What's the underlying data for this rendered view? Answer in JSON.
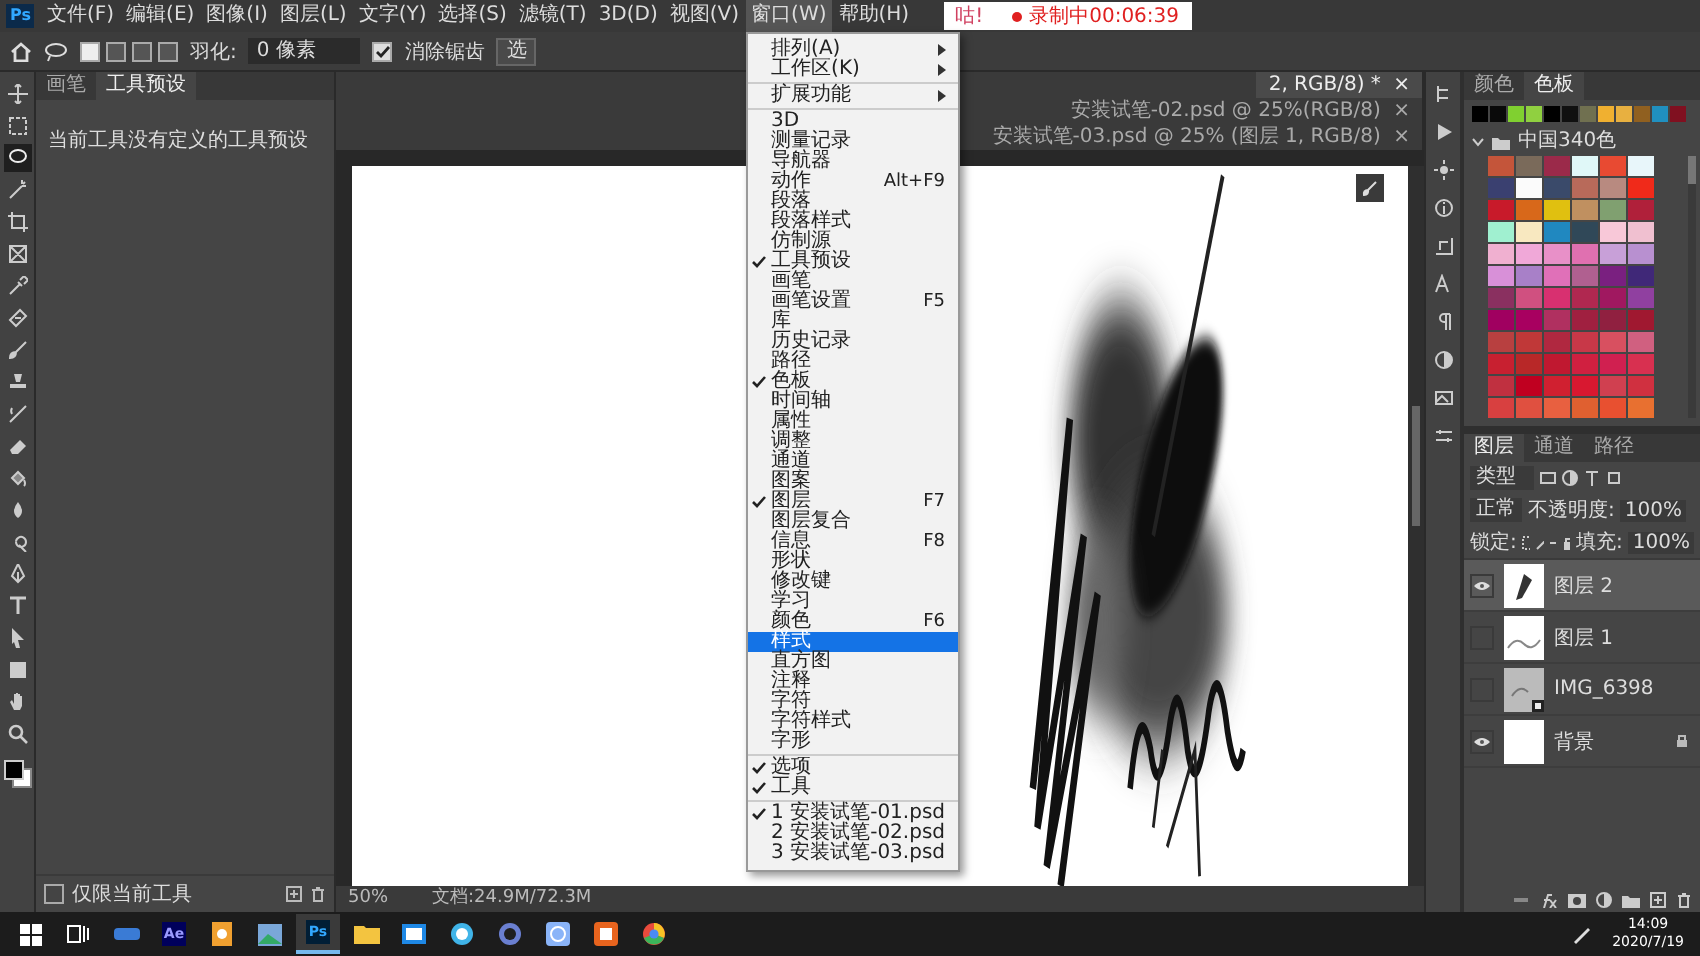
{
  "menu_bar": {
    "logo": "Ps",
    "items": [
      {
        "label": "文件(F)",
        "open": false
      },
      {
        "label": "编辑(E)",
        "open": false
      },
      {
        "label": "图像(I)",
        "open": false
      },
      {
        "label": "图层(L)",
        "open": false
      },
      {
        "label": "文字(Y)",
        "open": false
      },
      {
        "label": "选择(S)",
        "open": false
      },
      {
        "label": "滤镜(T)",
        "open": false
      },
      {
        "label": "3D(D)",
        "open": false
      },
      {
        "label": "视图(V)",
        "open": false
      },
      {
        "label": "窗口(W)",
        "open": true
      },
      {
        "label": "帮助(H)",
        "open": false
      }
    ]
  },
  "recording": {
    "app": "咕!",
    "status": "录制中00:06:39"
  },
  "window_menu": {
    "groups": [
      {
        "items": [
          {
            "label": "排列(A)",
            "kind": "submenu",
            "checked": false,
            "selected": false
          },
          {
            "label": "工作区(K)",
            "kind": "submenu",
            "checked": false,
            "selected": false
          }
        ]
      },
      {
        "items": [
          {
            "label": "扩展功能",
            "kind": "submenu",
            "checked": false,
            "selected": false
          }
        ]
      },
      {
        "items": [
          {
            "label": "3D",
            "kind": "command",
            "checked": false,
            "selected": false
          },
          {
            "label": "测量记录",
            "kind": "command",
            "checked": false,
            "selected": false
          },
          {
            "label": "导航器",
            "kind": "command",
            "checked": false,
            "selected": false
          },
          {
            "label": "动作",
            "shortcut": "Alt+F9",
            "kind": "command",
            "checked": false,
            "selected": false
          },
          {
            "label": "段落",
            "kind": "command",
            "checked": false,
            "selected": false
          },
          {
            "label": "段落样式",
            "kind": "command",
            "checked": false,
            "selected": false
          },
          {
            "label": "仿制源",
            "kind": "command",
            "checked": false,
            "selected": false
          },
          {
            "label": "工具预设",
            "kind": "command",
            "checked": true,
            "selected": false
          },
          {
            "label": "画笔",
            "kind": "command",
            "checked": false,
            "selected": false
          },
          {
            "label": "画笔设置",
            "shortcut": "F5",
            "kind": "command",
            "checked": false,
            "selected": false
          },
          {
            "label": "库",
            "kind": "command",
            "checked": false,
            "selected": false
          },
          {
            "label": "历史记录",
            "kind": "command",
            "checked": false,
            "selected": false
          },
          {
            "label": "路径",
            "kind": "command",
            "checked": false,
            "selected": false
          },
          {
            "label": "色板",
            "kind": "command",
            "checked": true,
            "selected": false
          },
          {
            "label": "时间轴",
            "kind": "command",
            "checked": false,
            "selected": false
          },
          {
            "label": "属性",
            "kind": "command",
            "checked": false,
            "selected": false
          },
          {
            "label": "调整",
            "kind": "command",
            "checked": false,
            "selected": false
          },
          {
            "label": "通道",
            "kind": "command",
            "checked": false,
            "selected": false
          },
          {
            "label": "图案",
            "kind": "command",
            "checked": false,
            "selected": false
          },
          {
            "label": "图层",
            "shortcut": "F7",
            "kind": "command",
            "checked": true,
            "selected": false
          },
          {
            "label": "图层复合",
            "kind": "command",
            "checked": false,
            "selected": false
          },
          {
            "label": "信息",
            "shortcut": "F8",
            "kind": "command",
            "checked": false,
            "selected": false
          },
          {
            "label": "形状",
            "kind": "command",
            "checked": false,
            "selected": false
          },
          {
            "label": "修改键",
            "kind": "command",
            "checked": false,
            "selected": false
          },
          {
            "label": "学习",
            "kind": "command",
            "checked": false,
            "selected": false
          },
          {
            "label": "颜色",
            "shortcut": "F6",
            "kind": "command",
            "checked": false,
            "selected": false
          },
          {
            "label": "样式",
            "kind": "command",
            "checked": false,
            "selected": true
          },
          {
            "label": "直方图",
            "kind": "command",
            "checked": false,
            "selected": false
          },
          {
            "label": "注释",
            "kind": "command",
            "checked": false,
            "selected": false
          },
          {
            "label": "字符",
            "kind": "command",
            "checked": false,
            "selected": false
          },
          {
            "label": "字符样式",
            "kind": "command",
            "checked": false,
            "selected": false
          },
          {
            "label": "字形",
            "kind": "command",
            "checked": false,
            "selected": false
          }
        ]
      },
      {
        "items": [
          {
            "label": "选项",
            "kind": "command",
            "checked": true,
            "selected": false
          },
          {
            "label": "工具",
            "kind": "command",
            "checked": true,
            "selected": false
          }
        ]
      },
      {
        "items": [
          {
            "label": "1 安装试笔-01.psd",
            "kind": "command",
            "checked": true,
            "selected": false
          },
          {
            "label": "2 安装试笔-02.psd",
            "kind": "command",
            "checked": false,
            "selected": false
          },
          {
            "label": "3 安装试笔-03.psd",
            "kind": "command",
            "checked": false,
            "selected": false
          }
        ]
      }
    ]
  },
  "options_bar": {
    "modes": [
      {
        "selected": true
      },
      {
        "selected": false
      },
      {
        "selected": false
      },
      {
        "selected": false
      }
    ],
    "feather_label": "羽化:",
    "feather_value": "0 像素",
    "antialias": {
      "label": "消除锯齿",
      "checked": true
    },
    "select_button": "选"
  },
  "toolbar": {
    "tools": [
      {
        "kind": "move",
        "selected": false
      },
      {
        "kind": "marquee",
        "selected": false
      },
      {
        "kind": "lasso",
        "selected": true
      },
      {
        "kind": "wand",
        "selected": false
      },
      {
        "kind": "crop",
        "selected": false
      },
      {
        "kind": "frame",
        "selected": false
      },
      {
        "kind": "eyedropper",
        "selected": false
      },
      {
        "kind": "healing",
        "selected": false
      },
      {
        "kind": "brush",
        "selected": false
      },
      {
        "kind": "stamp",
        "selected": false
      },
      {
        "kind": "history",
        "selected": false
      },
      {
        "kind": "eraser",
        "selected": false
      },
      {
        "kind": "bucket",
        "selected": false
      },
      {
        "kind": "blur",
        "selected": false
      },
      {
        "kind": "dodge",
        "selected": false
      },
      {
        "kind": "pen",
        "selected": false
      },
      {
        "kind": "text",
        "selected": false
      },
      {
        "kind": "path",
        "selected": false
      },
      {
        "kind": "shape",
        "selected": false
      },
      {
        "kind": "hand",
        "selected": false
      },
      {
        "kind": "zoom",
        "selected": false
      }
    ]
  },
  "left_panel": {
    "tabs": [
      {
        "label": "画笔",
        "selected": false
      },
      {
        "label": "工具预设",
        "selected": true
      }
    ],
    "message": "当前工具没有定义的工具预设",
    "current_tool_only": {
      "label": "仅限当前工具",
      "checked": false
    }
  },
  "document_tabs": [
    {
      "label": "2, RGB/8) *",
      "close": "×",
      "selected": true
    },
    {
      "label": "安装试笔-02.psd @ 25%(RGB/8)",
      "close": "×",
      "selected": false
    },
    {
      "label": "安装试笔-03.psd @ 25% (图层 1, RGB/8)",
      "close": "×",
      "selected": false
    }
  ],
  "status_bar": {
    "zoom": "50%",
    "document": "文档:24.9M/72.3M"
  },
  "swatches_panel": {
    "tabs": [
      {
        "label": "颜色",
        "selected": false
      },
      {
        "label": "色板",
        "selected": true
      }
    ],
    "recent": [
      {
        "color": "#000000"
      },
      {
        "color": "#0a0a0a"
      },
      {
        "color": "#80d030"
      },
      {
        "color": "#90d040"
      },
      {
        "color": "#000000"
      },
      {
        "color": "#101010"
      },
      {
        "color": "#707050"
      },
      {
        "color": "#f0b030"
      },
      {
        "color": "#e8b040"
      },
      {
        "color": "#906020"
      },
      {
        "color": "#2090c0"
      },
      {
        "color": "#801020"
      }
    ],
    "group": {
      "name": "中国340色",
      "expanded": true,
      "swatches": [
        {
          "color": "#c4553a"
        },
        {
          "color": "#7a6a5a"
        },
        {
          "color": "#9b2a4a"
        },
        {
          "color": "#e0f8f8"
        },
        {
          "color": "#e84a32"
        },
        {
          "color": "#e8f6fa"
        },
        {
          "color": "#3a4070"
        },
        {
          "color": "#fbfbfb"
        },
        {
          "color": "#3a4a6a"
        },
        {
          "color": "#b86a5a"
        },
        {
          "color": "#b88a80"
        },
        {
          "color": "#f02a1a"
        },
        {
          "color": "#c81a2a"
        },
        {
          "color": "#d8681a"
        },
        {
          "color": "#e0c010"
        },
        {
          "color": "#c09060"
        },
        {
          "color": "#80a070"
        },
        {
          "color": "#b0203a"
        },
        {
          "color": "#a0f0d0"
        },
        {
          "color": "#f8e8c0"
        },
        {
          "color": "#2088c0"
        },
        {
          "color": "#304858"
        },
        {
          "color": "#f8c8d8"
        },
        {
          "color": "#f0c0d0"
        },
        {
          "color": "#f0b0d0"
        },
        {
          "color": "#f0a8d8"
        },
        {
          "color": "#e890c8"
        },
        {
          "color": "#e070b0"
        },
        {
          "color": "#c8a0d8"
        },
        {
          "color": "#b890d0"
        },
        {
          "color": "#d890d8"
        },
        {
          "color": "#a880c8"
        },
        {
          "color": "#e070b8"
        },
        {
          "color": "#b06090"
        },
        {
          "color": "#7a2080"
        },
        {
          "color": "#402878"
        },
        {
          "color": "#8a3060"
        },
        {
          "color": "#d05080"
        },
        {
          "color": "#d83070"
        },
        {
          "color": "#b02850"
        },
        {
          "color": "#a01860"
        },
        {
          "color": "#9040a0"
        },
        {
          "color": "#a00060"
        },
        {
          "color": "#a80060"
        },
        {
          "color": "#b03060"
        },
        {
          "color": "#a02040"
        },
        {
          "color": "#902040"
        },
        {
          "color": "#a01830"
        },
        {
          "color": "#b84040"
        },
        {
          "color": "#c03838"
        },
        {
          "color": "#b02840"
        },
        {
          "color": "#c83848"
        },
        {
          "color": "#d85060"
        },
        {
          "color": "#d06080"
        },
        {
          "color": "#c82030"
        },
        {
          "color": "#b82828"
        },
        {
          "color": "#c01830"
        },
        {
          "color": "#d02040"
        },
        {
          "color": "#d02050"
        },
        {
          "color": "#d83050"
        },
        {
          "color": "#c03040"
        },
        {
          "color": "#c00020"
        },
        {
          "color": "#d02030"
        },
        {
          "color": "#d81830"
        },
        {
          "color": "#d04050"
        },
        {
          "color": "#d03040"
        },
        {
          "color": "#d84040"
        },
        {
          "color": "#e05040"
        },
        {
          "color": "#e86040"
        },
        {
          "color": "#e06030"
        },
        {
          "color": "#e85030"
        },
        {
          "color": "#e87030"
        }
      ]
    }
  },
  "layers_panel": {
    "tabs": [
      {
        "label": "图层",
        "selected": true
      },
      {
        "label": "通道",
        "selected": false
      },
      {
        "label": "路径",
        "selected": false
      }
    ],
    "filter": "类型",
    "blend_mode": "正常",
    "opacity_label": "不透明度:",
    "opacity": "100%",
    "lock_label": "锁定:",
    "fill_label": "填充:",
    "fill": "100%",
    "layers": [
      {
        "name": "图层 2",
        "kind": "ink",
        "visible": true,
        "selected": true,
        "locked": false
      },
      {
        "name": "图层 1",
        "kind": "sketch",
        "visible": false,
        "selected": false,
        "locked": false
      },
      {
        "name": "IMG_6398",
        "kind": "smart",
        "visible": false,
        "selected": false,
        "locked": false
      },
      {
        "name": "背景",
        "kind": "blank",
        "visible": true,
        "selected": false,
        "locked": true
      }
    ]
  },
  "taskbar": {
    "apps": [
      {
        "kind": "start",
        "selected": false
      },
      {
        "kind": "taskview",
        "selected": false
      },
      {
        "kind": "media",
        "selected": false
      },
      {
        "kind": "ae",
        "label": "Ae",
        "selected": false
      },
      {
        "kind": "viewer",
        "selected": false
      },
      {
        "kind": "photos",
        "selected": false
      },
      {
        "kind": "ps",
        "label": "Ps",
        "selected": true
      },
      {
        "kind": "folder",
        "selected": false
      },
      {
        "kind": "window",
        "selected": false
      },
      {
        "kind": "ring",
        "selected": false
      },
      {
        "kind": "browser",
        "selected": false
      },
      {
        "kind": "globe",
        "selected": false
      },
      {
        "kind": "office",
        "selected": false
      },
      {
        "kind": "chrome",
        "selected": false
      }
    ],
    "time": "14:09",
    "date": "2020/7/19"
  }
}
